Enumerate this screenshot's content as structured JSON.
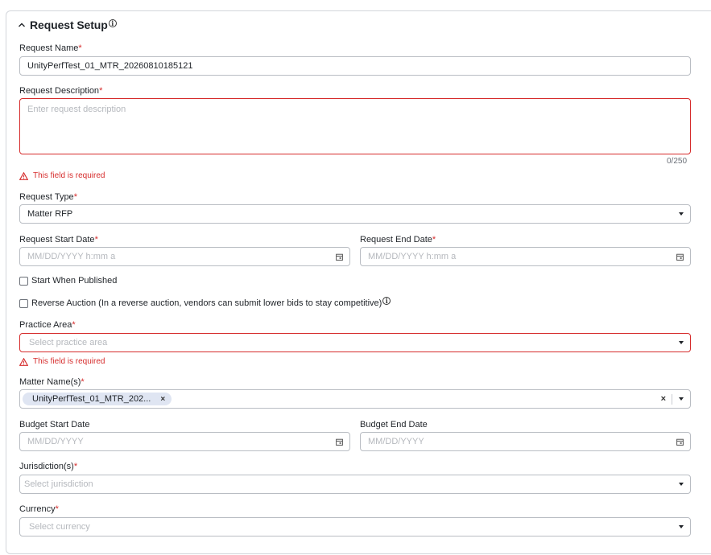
{
  "section": {
    "title": "Request Setup"
  },
  "request_name": {
    "label": "Request Name",
    "required_mark": "*",
    "value": "UnityPerfTest_01_MTR_20260810185121"
  },
  "request_description": {
    "label": "Request Description",
    "required_mark": "*",
    "placeholder": "Enter request description",
    "counter": "0/250",
    "error": "This field is required"
  },
  "request_type": {
    "label": "Request Type",
    "required_mark": "*",
    "value": "Matter RFP"
  },
  "request_start_date": {
    "label": "Request Start Date",
    "required_mark": "*",
    "placeholder": "MM/DD/YYYY h:mm a"
  },
  "request_end_date": {
    "label": "Request End Date",
    "required_mark": "*",
    "placeholder": "MM/DD/YYYY h:mm a"
  },
  "start_when_published": {
    "label": "Start When Published",
    "checked": false
  },
  "reverse_auction": {
    "label": "Reverse Auction (In a reverse auction, vendors can submit lower bids to stay competitive)",
    "checked": false
  },
  "practice_area": {
    "label": "Practice Area",
    "required_mark": "*",
    "placeholder": "Select practice area",
    "error": "This field is required"
  },
  "matter_names": {
    "label": "Matter Name(s)",
    "required_mark": "*",
    "chips": [
      "UnityPerfTest_01_MTR_202..."
    ],
    "chip_remove": "×",
    "clear": "×"
  },
  "budget_start_date": {
    "label": "Budget Start Date",
    "placeholder": "MM/DD/YYYY"
  },
  "budget_end_date": {
    "label": "Budget End Date",
    "placeholder": "MM/DD/YYYY"
  },
  "jurisdictions": {
    "label": "Jurisdiction(s)",
    "required_mark": "*",
    "placeholder": "Select jurisdiction"
  },
  "currency": {
    "label": "Currency",
    "required_mark": "*",
    "placeholder": "Select currency"
  },
  "icons": {
    "collapse": "chevron-up-icon",
    "info": "info-icon",
    "warning": "warning-icon",
    "calendar": "calendar-icon",
    "dropdown": "caret-down-icon"
  },
  "colors": {
    "error": "#d62c2c",
    "border": "#b9bdc3",
    "chip_bg": "#dfe5f2",
    "placeholder": "#b5b8bd"
  }
}
